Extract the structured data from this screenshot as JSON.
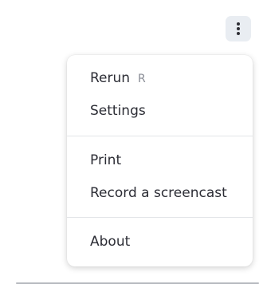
{
  "header": {
    "menu_button_icon": "kebab-vertical-icon"
  },
  "menu": {
    "items": [
      {
        "label": "Rerun",
        "shortcut": "R"
      },
      {
        "label": "Settings"
      },
      {
        "label": "Print"
      },
      {
        "label": "Record a screencast"
      },
      {
        "label": "About"
      }
    ]
  },
  "colors": {
    "button_bg": "#e9edf2",
    "text": "#2c2d35",
    "shortcut": "#8a8d96",
    "divider": "#e3e5e8"
  }
}
